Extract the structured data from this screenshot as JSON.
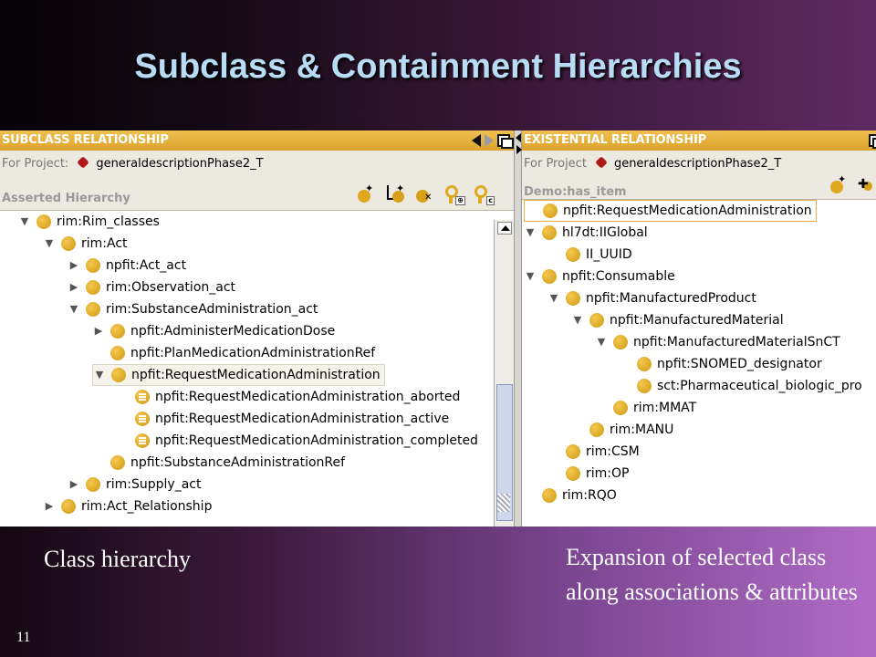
{
  "slide": {
    "title": "Subclass & Containment Hierarchies",
    "caption_left": "Class hierarchy",
    "caption_right": "Expansion of selected class along associations & attributes",
    "slide_number": "11"
  },
  "left_panel": {
    "header": "SUBCLASS RELATIONSHIP",
    "project_label": "For Project:",
    "project_name": "generaldescriptionPhase2_T",
    "section_label": "Asserted Hierarchy",
    "tree": [
      {
        "label": "rim:Rim_classes",
        "indent": 0,
        "toggle": "expanded",
        "icon": "class-icon"
      },
      {
        "label": "rim:Act",
        "indent": 1,
        "toggle": "expanded",
        "icon": "class-icon"
      },
      {
        "label": "npfit:Act_act",
        "indent": 2,
        "toggle": "collapsed",
        "icon": "class-icon"
      },
      {
        "label": "rim:Observation_act",
        "indent": 2,
        "toggle": "collapsed",
        "icon": "class-icon"
      },
      {
        "label": "rim:SubstanceAdministration_act",
        "indent": 2,
        "toggle": "expanded",
        "icon": "class-icon"
      },
      {
        "label": "npfit:AdministerMedicationDose",
        "indent": 3,
        "toggle": "collapsed",
        "icon": "class-icon"
      },
      {
        "label": "npfit:PlanMedicationAdministrationRef",
        "indent": 3,
        "toggle": "none",
        "icon": "class-icon"
      },
      {
        "label": "npfit:RequestMedicationAdministration",
        "indent": 3,
        "toggle": "expanded",
        "icon": "class-icon",
        "selected": true
      },
      {
        "label": "npfit:RequestMedicationAdministration_aborted",
        "indent": 4,
        "toggle": "none",
        "icon": "enum-class-icon"
      },
      {
        "label": "npfit:RequestMedicationAdministration_active",
        "indent": 4,
        "toggle": "none",
        "icon": "enum-class-icon"
      },
      {
        "label": "npfit:RequestMedicationAdministration_completed",
        "indent": 4,
        "toggle": "none",
        "icon": "enum-class-icon"
      },
      {
        "label": "npfit:SubstanceAdministrationRef",
        "indent": 3,
        "toggle": "none",
        "icon": "class-icon"
      },
      {
        "label": "rim:Supply_act",
        "indent": 2,
        "toggle": "collapsed",
        "icon": "class-icon"
      },
      {
        "label": "rim:Act_Relationship",
        "indent": 1,
        "toggle": "collapsed",
        "icon": "class-icon"
      }
    ]
  },
  "right_panel": {
    "header": "EXISTENTIAL RELATIONSHIP",
    "project_label": "For Project",
    "project_name": "generaldescriptionPhase2_T",
    "section_label": "Demo:has_item",
    "tree": [
      {
        "label": "npfit:RequestMedicationAdministration",
        "indent": 0,
        "toggle": "none",
        "icon": "class-icon",
        "selected": true
      },
      {
        "label": "hl7dt:IIGlobal",
        "indent": 0,
        "toggle": "expanded",
        "icon": "class-icon"
      },
      {
        "label": "II_UUID",
        "indent": 1,
        "toggle": "none",
        "icon": "class-icon"
      },
      {
        "label": "npfit:Consumable",
        "indent": 0,
        "toggle": "expanded",
        "icon": "class-icon"
      },
      {
        "label": "npfit:ManufacturedProduct",
        "indent": 1,
        "toggle": "expanded",
        "icon": "class-icon"
      },
      {
        "label": "npfit:ManufacturedMaterial",
        "indent": 2,
        "toggle": "expanded",
        "icon": "class-icon"
      },
      {
        "label": "npfit:ManufacturedMaterialSnCT",
        "indent": 3,
        "toggle": "expanded",
        "icon": "class-icon"
      },
      {
        "label": "npfit:SNOMED_designator",
        "indent": 4,
        "toggle": "none",
        "icon": "class-icon"
      },
      {
        "label": "sct:Pharmaceutical_biologic_pro",
        "indent": 4,
        "toggle": "none",
        "icon": "class-icon"
      },
      {
        "label": "rim:MMAT",
        "indent": 3,
        "toggle": "none",
        "icon": "class-icon"
      },
      {
        "label": "rim:MANU",
        "indent": 2,
        "toggle": "none",
        "icon": "class-icon"
      },
      {
        "label": "rim:CSM",
        "indent": 1,
        "toggle": "none",
        "icon": "class-icon"
      },
      {
        "label": "rim:OP",
        "indent": 1,
        "toggle": "none",
        "icon": "class-icon"
      },
      {
        "label": "rim:RQO",
        "indent": 0,
        "toggle": "none",
        "icon": "class-icon"
      }
    ]
  },
  "icons": {
    "left_toolbar": [
      "create-subclass-icon",
      "create-sibling-icon",
      "delete-class-icon",
      "add-superclass-key-icon",
      "remove-superclass-key-icon"
    ],
    "right_toolbar": [
      "create-class-icon",
      "add-restriction-icon"
    ]
  }
}
